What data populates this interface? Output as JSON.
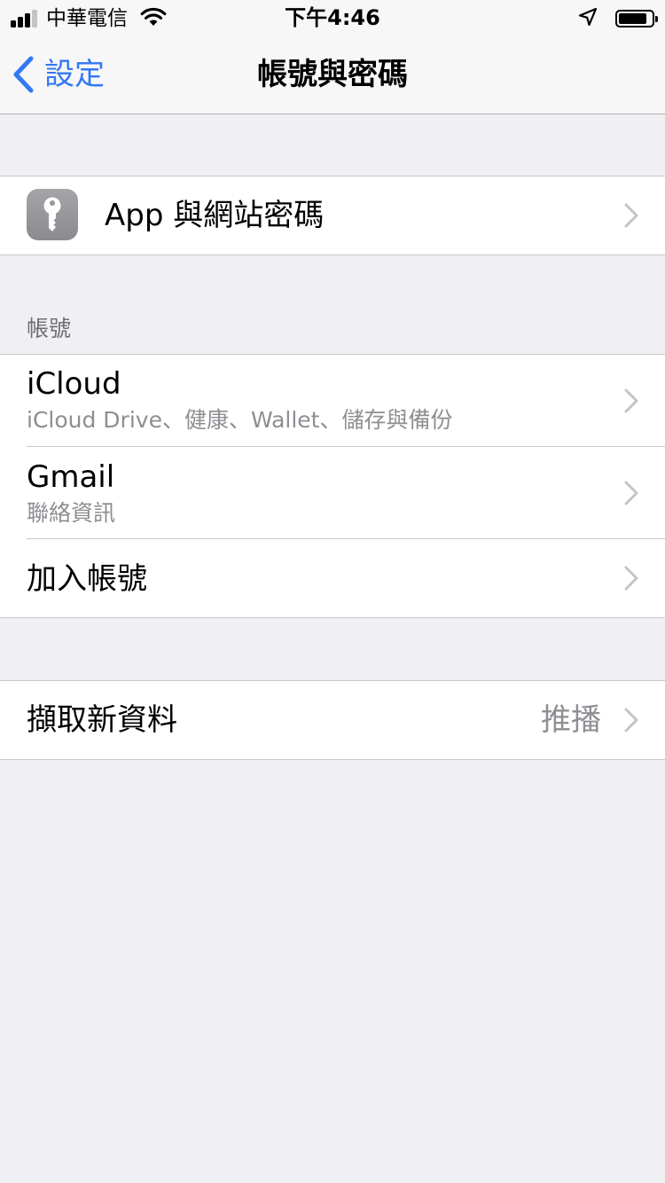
{
  "status_bar": {
    "carrier": "中華電信",
    "time": "下午4:46",
    "signal_bars_active": 3,
    "signal_bars_total": 4,
    "battery_level_percent": 85
  },
  "nav": {
    "back_label": "設定",
    "title": "帳號與密碼"
  },
  "passwords_group": {
    "label": "App 與網站密碼",
    "icon": "key-icon"
  },
  "accounts_section": {
    "header": "帳號",
    "items": [
      {
        "title": "iCloud",
        "subtitle": "iCloud Drive、健康、Wallet、儲存與備份"
      },
      {
        "title": "Gmail",
        "subtitle": "聯絡資訊"
      },
      {
        "title": "加入帳號"
      }
    ]
  },
  "fetch_group": {
    "label": "擷取新資料",
    "value": "推播"
  },
  "colors": {
    "accent": "#3478f6",
    "background": "#efeff4",
    "secondary_text": "#8e8e93"
  }
}
